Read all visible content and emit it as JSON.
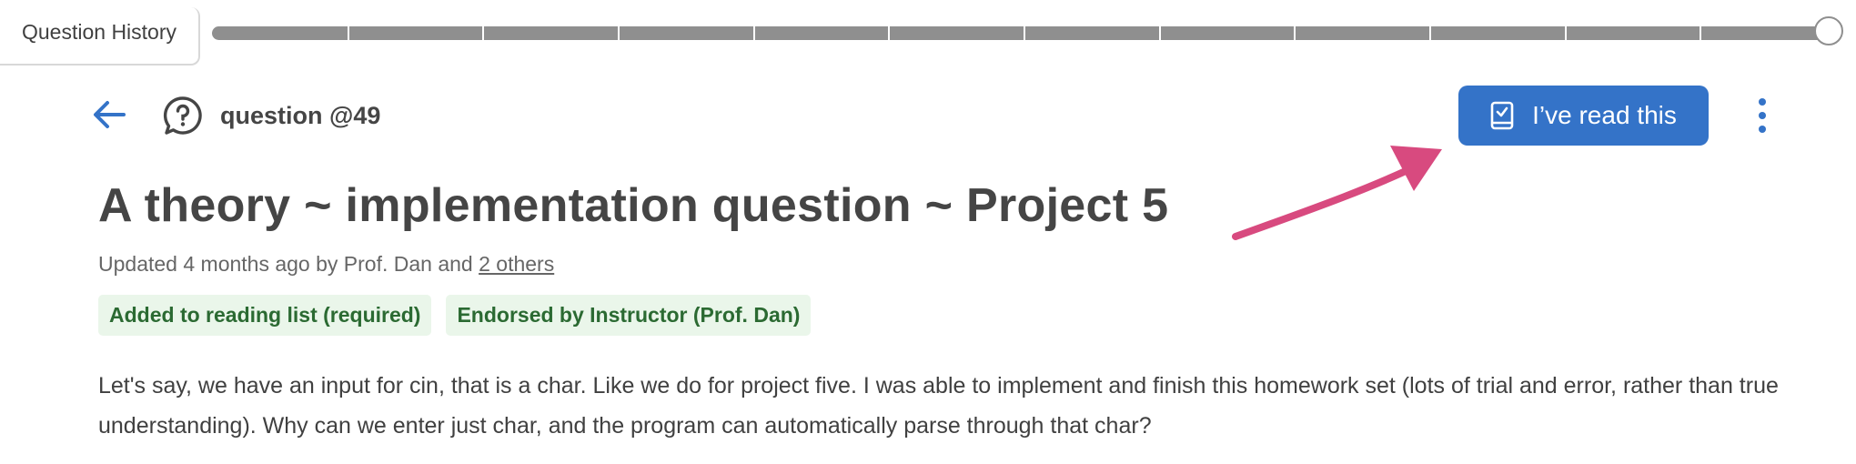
{
  "history": {
    "label": "Question History",
    "tick_count": 12
  },
  "header": {
    "question_label": "question @49",
    "read_button_label": "I’ve read this"
  },
  "post": {
    "title": "A theory ~ implementation question ~ Project 5",
    "meta_prefix": "Updated 4 months ago by Prof. Dan and ",
    "meta_link": "2 others",
    "badges": [
      "Added to reading list (required)",
      "Endorsed by Instructor (Prof. Dan)"
    ],
    "body": "Let's say, we have an input for cin, that is a char. Like we do for project five. I was able to implement and finish this homework set (lots of trial and error, rather than true understanding). Why can we enter just char, and the program can automatically parse through that char?"
  },
  "colors": {
    "accent": "#3473c8",
    "arrow": "#d84a7f",
    "badge_bg": "#eaf6ea",
    "badge_text": "#2b6a32"
  },
  "icons": {
    "back": "arrow-left-icon",
    "question": "question-bubble-icon",
    "read": "book-check-icon",
    "more": "kebab-menu-icon"
  }
}
